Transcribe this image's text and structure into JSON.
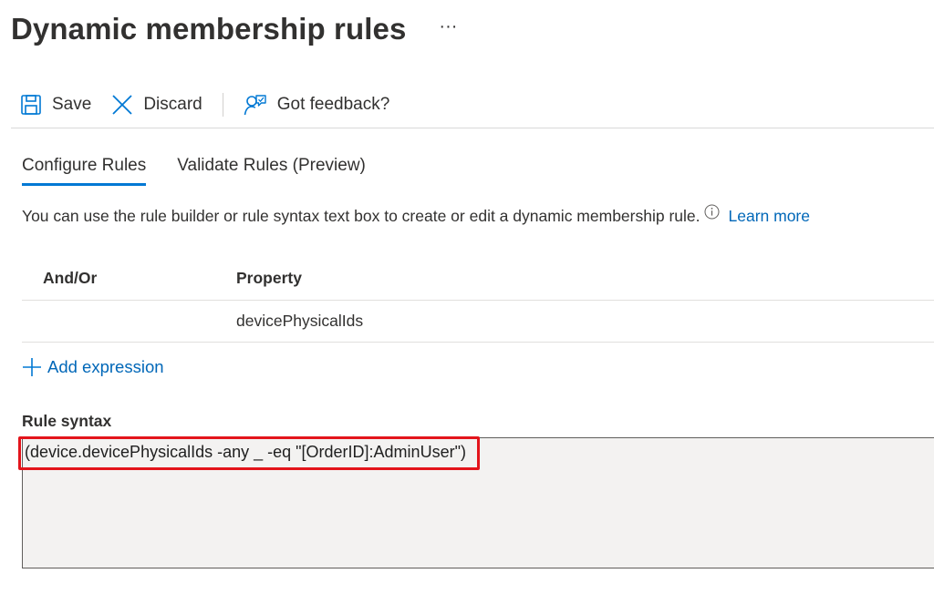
{
  "header": {
    "title": "Dynamic membership rules",
    "more": "···"
  },
  "toolbar": {
    "save_label": "Save",
    "discard_label": "Discard",
    "feedback_label": "Got feedback?"
  },
  "tabs": [
    {
      "label": "Configure Rules",
      "active": true
    },
    {
      "label": "Validate Rules (Preview)",
      "active": false
    }
  ],
  "description": {
    "text": "You can use the rule builder or rule syntax text box to create or edit a dynamic membership rule.",
    "learn_more": "Learn more"
  },
  "rules_table": {
    "headers": {
      "and_or": "And/Or",
      "property": "Property"
    },
    "rows": [
      {
        "and_or": "",
        "property": "devicePhysicalIds"
      }
    ]
  },
  "add_expression_label": "Add expression",
  "rule_syntax": {
    "label": "Rule syntax",
    "value": "(device.devicePhysicalIds -any _ -eq \"[OrderID]:AdminUser\")"
  },
  "colors": {
    "accent": "#0078d4",
    "link": "#0067b8",
    "highlight": "#e3141b",
    "syntax_bg": "#f3f2f1"
  }
}
